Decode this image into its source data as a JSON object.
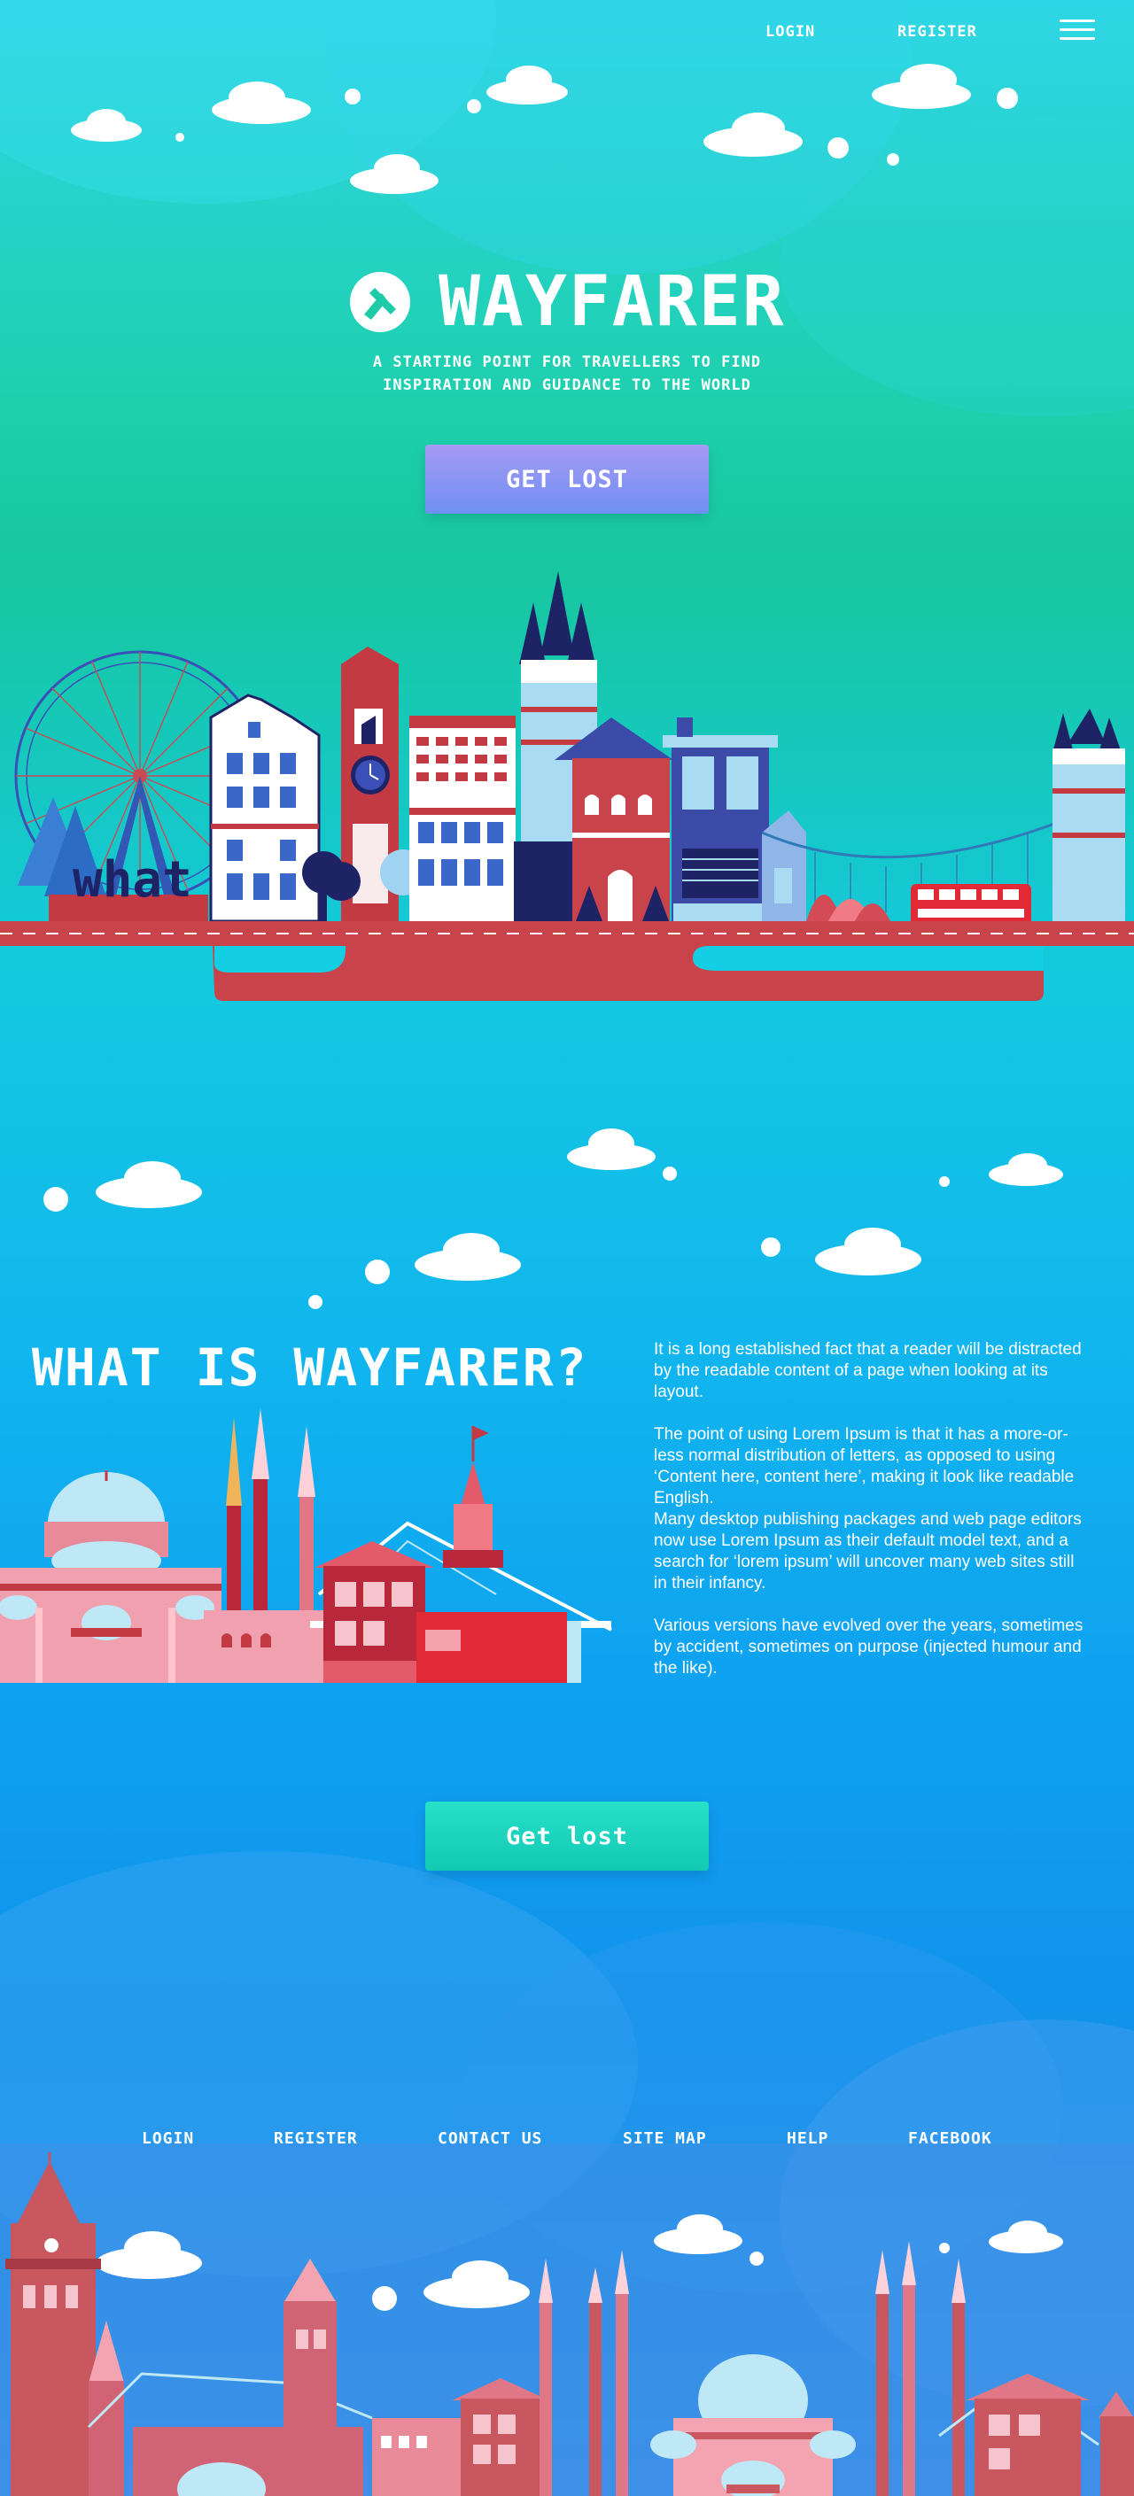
{
  "nav": {
    "login": "LOGIN",
    "register": "REGISTER",
    "menu_icon": "hamburger-icon"
  },
  "hero": {
    "brand": "WAYFARER",
    "logo_icon": "compass-logo-icon",
    "tagline_line1": "A STARTING POINT FOR TRAVELLERS TO FIND",
    "tagline_line2": "INSPIRATION AND GUIDANCE TO THE WORLD",
    "cta": "GET LOST"
  },
  "city_sign_partial": "what",
  "about": {
    "title": "WHAT IS WAYFARER?",
    "p1": "It is a long established fact that a reader will be distracted by the readable content of a page when looking at its layout.",
    "p2": "The point of using Lorem Ipsum is that it has a more-or-less normal distribution of letters, as opposed to using ‘Content here, content here’, making it look like readable English.",
    "p3": "Many desktop publishing packages and web page editors now use Lorem Ipsum as their default model text, and a search for ‘lorem ipsum’ will uncover many web sites still in their infancy.",
    "p4": "Various versions have evolved over the years, sometimes by accident, sometimes on purpose (injected humour and the like)."
  },
  "cta2": "Get lost",
  "footer": {
    "links": [
      "LOGIN",
      "REGISTER",
      "CONTACT US",
      "SITE MAP",
      "HELP",
      "FACEBOOK"
    ]
  },
  "colors": {
    "accent_purple": "#8f95f3",
    "accent_teal": "#1fd6c0",
    "road_red": "#c9444a",
    "brick_red": "#c43a43",
    "navy": "#1e2366"
  }
}
